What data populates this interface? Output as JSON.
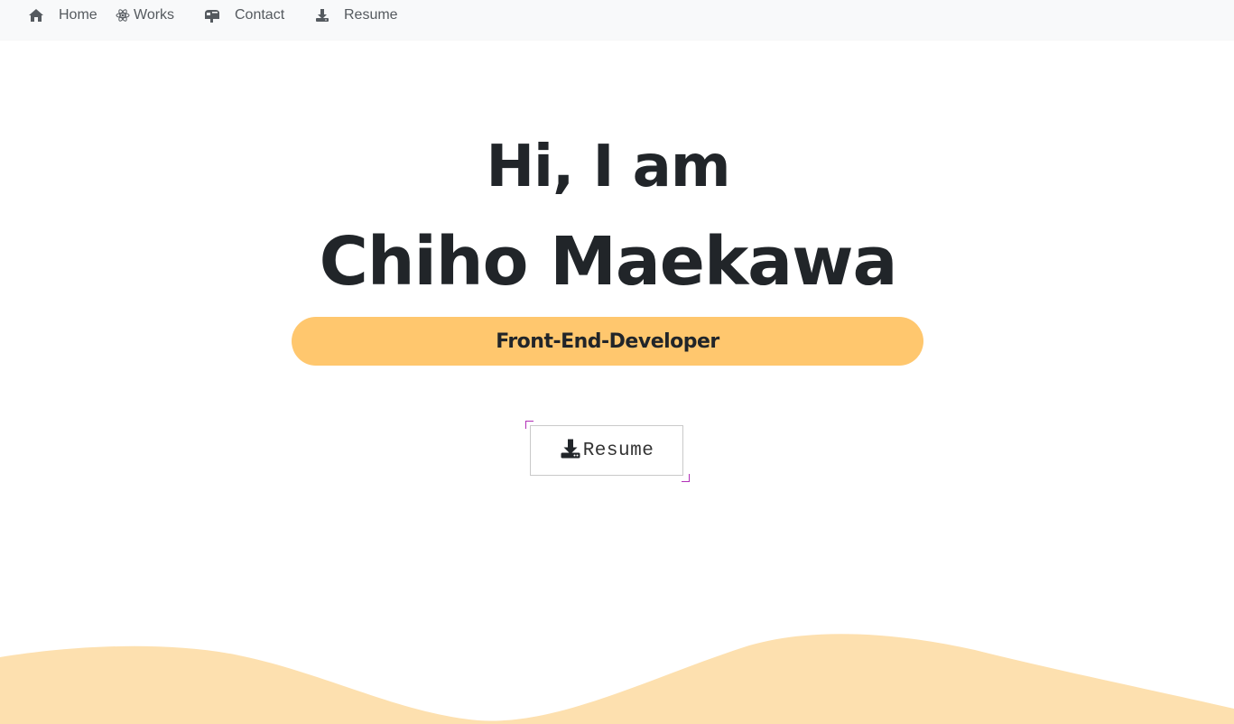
{
  "nav": {
    "home": {
      "label": "Home",
      "icon": "home-icon"
    },
    "works": {
      "label": "Works",
      "icon": "react-atom-icon"
    },
    "contact": {
      "label": "Contact",
      "icon": "mailbox-icon"
    },
    "resume": {
      "label": "Resume",
      "icon": "download-icon"
    }
  },
  "hero": {
    "greeting": "Hi, I am",
    "name": "Chiho Maekawa",
    "role": "Front-End-Developer",
    "resume_button": {
      "label": "Resume",
      "icon": "download-icon"
    }
  },
  "colors": {
    "nav_bg": "#f8f9fa",
    "nav_text": "#555a5f",
    "heading": "#212529",
    "accent": "#ffc76e",
    "wave": "#fde0af",
    "corner_accent": "#b12fb7"
  }
}
